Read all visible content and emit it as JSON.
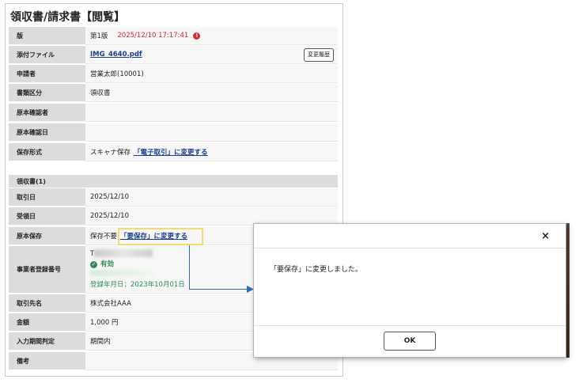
{
  "header": {
    "title": "領収書/請求書【閲覧】"
  },
  "rows": {
    "version": {
      "label": "版",
      "value": "第1版",
      "timestamp": "2025/12/10 17:17:41",
      "alert": "!"
    },
    "attachment": {
      "label": "添付ファイル",
      "value": "IMG_4640.pdf",
      "history_button": "変更履歴"
    },
    "applicant": {
      "label": "申請者",
      "value": "営業太郎(10001)"
    },
    "doc_type": {
      "label": "書類区分",
      "value": "領収書"
    },
    "orig_checker": {
      "label": "原本確認者",
      "value": ""
    },
    "orig_check_date": {
      "label": "原本確認日",
      "value": ""
    },
    "storage_format": {
      "label": "保存形式",
      "value": "スキャナ保存",
      "link": "「電子取引」に変更する"
    }
  },
  "section": {
    "label": "領収書(1)"
  },
  "detail": {
    "trade_date": {
      "label": "取引日",
      "value": "2025/12/10"
    },
    "receipt_date": {
      "label": "受領日",
      "value": "2025/12/10"
    },
    "orig_keep": {
      "label": "原本保存",
      "value": "保存不要",
      "link": "「要保存」に変更する"
    },
    "registration": {
      "label": "事業者登録番号",
      "prefix": "T",
      "status": "有効",
      "registered": "登録年月日：2023年10月01日"
    },
    "partner": {
      "label": "取引先名",
      "value": "株式会社AAA"
    },
    "amount": {
      "label": "金額",
      "value": "1,000 円"
    },
    "input_period": {
      "label": "入力期間判定",
      "value": "期間内"
    },
    "notes": {
      "label": "備考",
      "value": ""
    }
  },
  "dialog": {
    "close": "×",
    "message": "「要保存」に変更しました。",
    "ok": "OK"
  },
  "colors": {
    "link": "#1a3d8f",
    "warning": "#c8282d",
    "valid": "#2e8b57",
    "highlight": "#f3da78",
    "arrow": "#2a6fb6"
  },
  "icons": {
    "alert": "alert-circle-icon",
    "check": "check-circle-icon",
    "close": "close-icon"
  }
}
